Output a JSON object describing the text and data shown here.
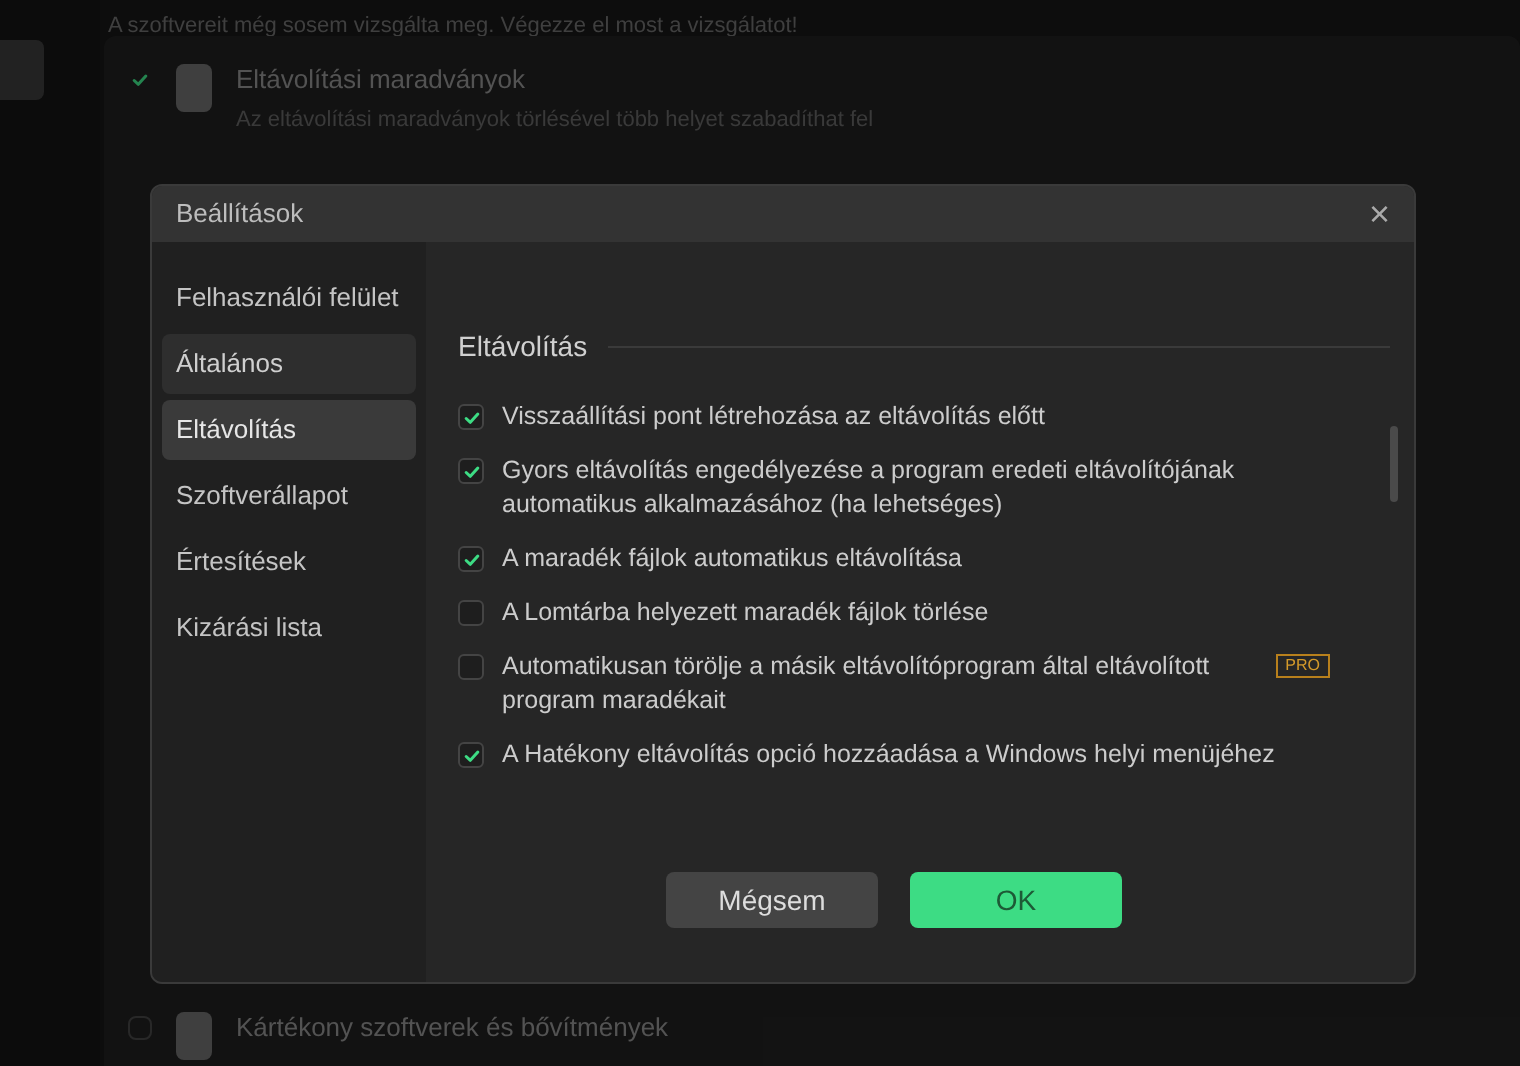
{
  "background": {
    "notice": "A szoftvereit még sosem vizsgálta meg. Végezze el most a vizsgálatot!",
    "items": [
      {
        "title": "Eltávolítási maradványok",
        "description": "Az eltávolítási maradványok törlésével több helyet szabadíthat fel",
        "checked": true
      },
      {
        "title": "Kártékony szoftverek és bővítmények",
        "checked": false
      }
    ]
  },
  "dialog": {
    "title": "Beállítások",
    "close": "×",
    "sidebar": [
      {
        "label": "Felhasználói felület",
        "selected": false,
        "hovered": false
      },
      {
        "label": "Általános",
        "selected": false,
        "hovered": true
      },
      {
        "label": "Eltávolítás",
        "selected": true,
        "hovered": false
      },
      {
        "label": "Szoftverállapot",
        "selected": false,
        "hovered": false
      },
      {
        "label": "Értesítések",
        "selected": false,
        "hovered": false
      },
      {
        "label": "Kizárási lista",
        "selected": false,
        "hovered": false
      }
    ],
    "section": "Eltávolítás",
    "options": [
      {
        "label": "Visszaállítási pont létrehozása az eltávolítás előtt",
        "checked": true
      },
      {
        "label": "Gyors eltávolítás engedélyezése a program eredeti eltávolítójának automatikus alkalmazásához (ha lehetséges)",
        "checked": true
      },
      {
        "label": "A maradék fájlok automatikus eltávolítása",
        "checked": true
      },
      {
        "label": "A Lomtárba helyezett maradék fájlok törlése",
        "checked": false
      },
      {
        "label": "Automatikusan törölje a másik eltávolítóprogram által eltávolított program maradékait",
        "checked": false,
        "badge": "PRO"
      },
      {
        "label": "A Hatékony eltávolítás opció hozzáadása a Windows helyi menüjéhez",
        "checked": true
      }
    ],
    "buttons": [
      {
        "label": "Mégsem",
        "kind": "secondary"
      },
      {
        "label": "OK",
        "kind": "primary"
      }
    ]
  }
}
